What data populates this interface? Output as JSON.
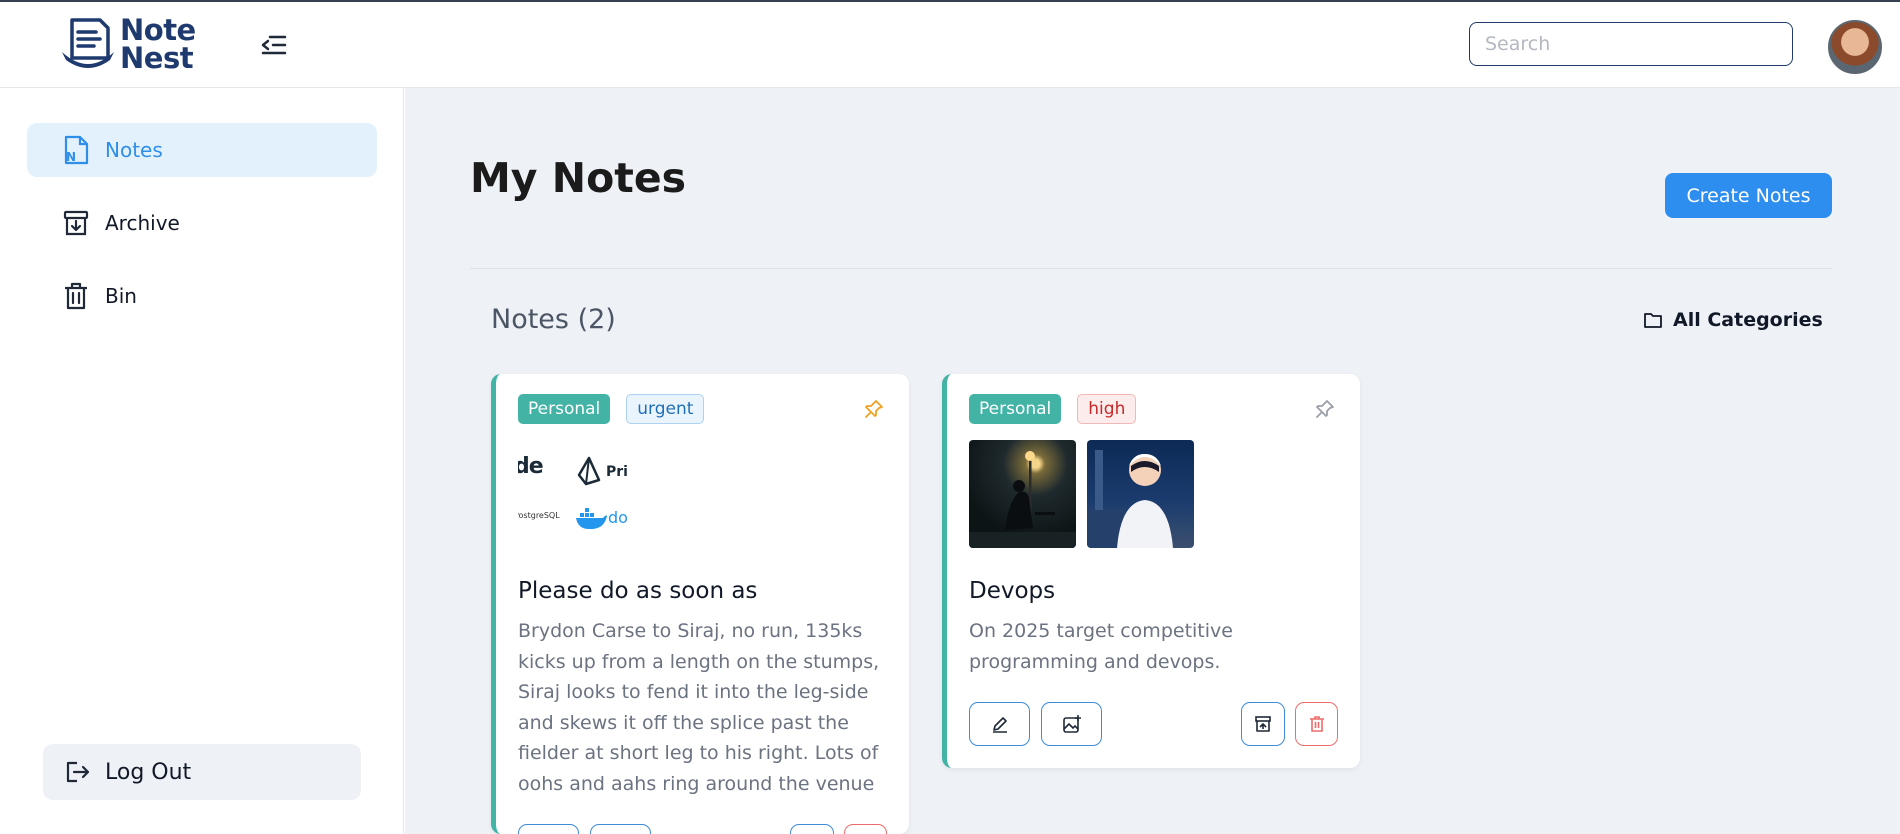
{
  "app": {
    "logo_line1": "Note",
    "logo_line2": "Nest"
  },
  "header": {
    "search_placeholder": "Search"
  },
  "sidebar": {
    "items": [
      {
        "label": "Notes",
        "icon": "notes-icon",
        "active": true
      },
      {
        "label": "Archive",
        "icon": "archive-icon",
        "active": false
      },
      {
        "label": "Bin",
        "icon": "trash-icon",
        "active": false
      }
    ],
    "logout_label": "Log Out"
  },
  "main": {
    "title": "My Notes",
    "create_label": "Create Notes",
    "notes_count_label": "Notes (2)",
    "categories_label": "All Categories"
  },
  "notes": [
    {
      "category": "Personal",
      "priority": "urgent",
      "pinned": true,
      "logo_texts": [
        "de",
        "Pri",
        "PostgreSQL",
        "do"
      ],
      "title": "Please do as soon as",
      "body": "Brydon Carse to Siraj, no run, 135ks kicks up from a length on the stumps, Siraj looks to fend it into the leg-side and skews it off the splice past the fielder at short leg to his right. Lots of oohs and aahs ring around the venue"
    },
    {
      "category": "Personal",
      "priority": "high",
      "pinned": false,
      "title": "Devops",
      "body": "On 2025 target competitive programming and devops."
    }
  ],
  "colors": {
    "accent": "#2d8ef0",
    "brand": "#1e3a6e",
    "tag_personal": "#42b3a5",
    "pin_active": "#f0a020",
    "danger": "#ee6b6b"
  }
}
